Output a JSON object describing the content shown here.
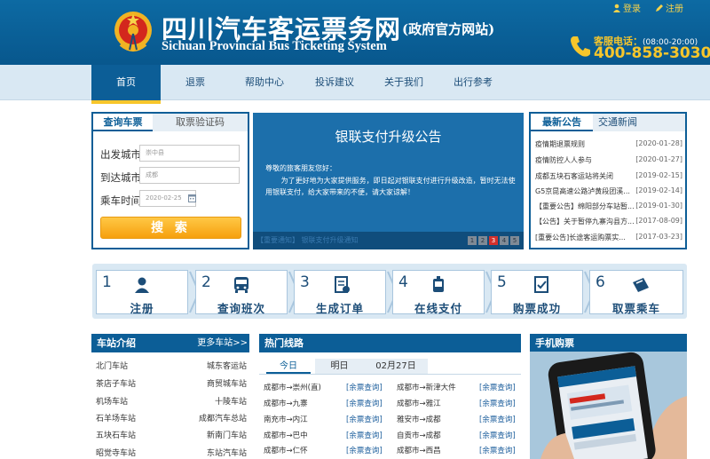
{
  "header": {
    "title_cn": "四川汽车客运票务网",
    "title_sub": "(政府官方网站)",
    "title_en": "Sichuan Provincial Bus Ticketing System",
    "login": "登录",
    "register": "注册",
    "hotline_label": "客服电话：",
    "hotline_hours": "(08:00-20:00)",
    "hotline_number": "400-858-3030"
  },
  "nav": [
    "首页",
    "退票",
    "帮助中心",
    "投诉建议",
    "关于我们",
    "出行参考"
  ],
  "search": {
    "tab_active": "查询车票",
    "tab_other": "取票验证码",
    "from_label": "出发城市:",
    "from_value": "崇中县",
    "to_label": "到达城市:",
    "to_value": "成都",
    "date_label": "乘车时间:",
    "date_value": "2020-02-25",
    "button": "搜 索"
  },
  "notice": {
    "title": "银联支付升级公告",
    "greeting": "尊敬的旅客朋友您好：",
    "body": "为了更好地为大家提供服务，即日起对银联支付进行升级改造，暂时无法使用银联支付，给大家带来的不便，请大家谅解！",
    "caption": "【重要通知】 银联支付升级通知",
    "pages": [
      "1",
      "2",
      "3",
      "4",
      "5"
    ],
    "active_page": 3
  },
  "news": {
    "tab_active": "最新公告",
    "tab_other": "交通新闻",
    "items": [
      {
        "title": "疫情期退票规则",
        "date": "[2020-01-28]"
      },
      {
        "title": "疫情防控人人参与",
        "date": "[2020-01-27]"
      },
      {
        "title": "成都五块石客运站将关闭",
        "date": "[2019-02-15]"
      },
      {
        "title": "G5京昆高速公路泸黄段团溪...",
        "date": "[2019-02-14]"
      },
      {
        "title": "【重要公告】绵阳部分车站暂...",
        "date": "[2019-01-30]"
      },
      {
        "title": "【公告】关于暂停九寨沟县方...",
        "date": "[2017-08-09]"
      },
      {
        "title": "[重要公告]长途客运购票实...",
        "date": "[2017-03-23]"
      }
    ]
  },
  "steps": [
    {
      "num": "1",
      "label": "注册",
      "icon": "user-icon"
    },
    {
      "num": "2",
      "label": "查询班次",
      "icon": "bus-icon"
    },
    {
      "num": "3",
      "label": "生成订单",
      "icon": "order-icon"
    },
    {
      "num": "4",
      "label": "在线支付",
      "icon": "payment-icon"
    },
    {
      "num": "5",
      "label": "购票成功",
      "icon": "success-icon"
    },
    {
      "num": "6",
      "label": "取票乘车",
      "icon": "ticket-icon"
    }
  ],
  "stations": {
    "title": "车站介绍",
    "more": "更多车站>>",
    "rows": [
      [
        "北门车站",
        "城东客运站"
      ],
      [
        "茶店子车站",
        "商贸城车站"
      ],
      [
        "机场车站",
        "十陵车站"
      ],
      [
        "石羊场车站",
        "成都汽车总站"
      ],
      [
        "五块石车站",
        "新南门车站"
      ],
      [
        "昭觉寺车站",
        "东站汽车站"
      ]
    ]
  },
  "routes": {
    "title": "热门线路",
    "tabs": [
      "今日",
      "明日",
      "02月27日"
    ],
    "query_label": "[余票查询]",
    "rows": [
      [
        "成都市→崇州(直)",
        "成都市→新津大件"
      ],
      [
        "成都市→九寨",
        "成都市→雅江"
      ],
      [
        "南充市→内江",
        "雅安市→成都"
      ],
      [
        "成都市→巴中",
        "自贡市→成都"
      ],
      [
        "成都市→仁怀",
        "成都市→西昌"
      ]
    ]
  },
  "mobile": {
    "title": "手机购票"
  },
  "colors": {
    "primary": "#0c5e97",
    "accent": "#f7c62b",
    "nav_bg": "#d9e8f3",
    "search_button": "#f6a00e"
  }
}
